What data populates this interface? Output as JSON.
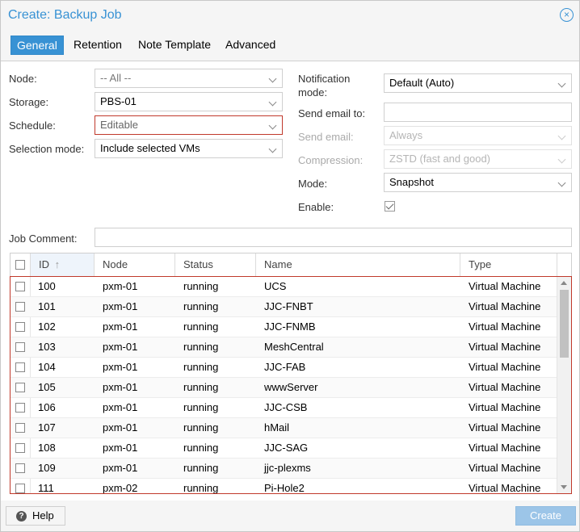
{
  "dialog": {
    "title": "Create: Backup Job",
    "close_icon": "×"
  },
  "tabs": [
    {
      "label": "General",
      "active": true
    },
    {
      "label": "Retention",
      "active": false
    },
    {
      "label": "Note Template",
      "active": false
    },
    {
      "label": "Advanced",
      "active": false
    }
  ],
  "form": {
    "node": {
      "label": "Node:",
      "value": "-- All --"
    },
    "storage": {
      "label": "Storage:",
      "value": "PBS-01"
    },
    "schedule": {
      "label": "Schedule:",
      "value": "Editable"
    },
    "selection_mode": {
      "label": "Selection mode:",
      "value": "Include selected VMs"
    },
    "notification_mode": {
      "label_line1": "Notification",
      "label_line2": "mode:",
      "value": "Default (Auto)"
    },
    "send_email_to": {
      "label": "Send email to:",
      "value": ""
    },
    "send_email": {
      "label": "Send email:",
      "value": "Always"
    },
    "compression": {
      "label": "Compression:",
      "value": "ZSTD (fast and good)"
    },
    "mode": {
      "label": "Mode:",
      "value": "Snapshot"
    },
    "enable": {
      "label": "Enable:",
      "checked": true
    },
    "job_comment": {
      "label": "Job Comment:",
      "value": ""
    }
  },
  "grid": {
    "columns": [
      "ID",
      "Node",
      "Status",
      "Name",
      "Type"
    ],
    "sort_icon": "↑",
    "rows": [
      {
        "id": "100",
        "node": "pxm-01",
        "status": "running",
        "name": "UCS",
        "type": "Virtual Machine"
      },
      {
        "id": "101",
        "node": "pxm-01",
        "status": "running",
        "name": "JJC-FNBT",
        "type": "Virtual Machine"
      },
      {
        "id": "102",
        "node": "pxm-01",
        "status": "running",
        "name": "JJC-FNMB",
        "type": "Virtual Machine"
      },
      {
        "id": "103",
        "node": "pxm-01",
        "status": "running",
        "name": "MeshCentral",
        "type": "Virtual Machine"
      },
      {
        "id": "104",
        "node": "pxm-01",
        "status": "running",
        "name": "JJC-FAB",
        "type": "Virtual Machine"
      },
      {
        "id": "105",
        "node": "pxm-01",
        "status": "running",
        "name": "wwwServer",
        "type": "Virtual Machine"
      },
      {
        "id": "106",
        "node": "pxm-01",
        "status": "running",
        "name": "JJC-CSB",
        "type": "Virtual Machine"
      },
      {
        "id": "107",
        "node": "pxm-01",
        "status": "running",
        "name": "hMail",
        "type": "Virtual Machine"
      },
      {
        "id": "108",
        "node": "pxm-01",
        "status": "running",
        "name": "JJC-SAG",
        "type": "Virtual Machine"
      },
      {
        "id": "109",
        "node": "pxm-01",
        "status": "running",
        "name": "jjc-plexms",
        "type": "Virtual Machine"
      },
      {
        "id": "111",
        "node": "pxm-02",
        "status": "running",
        "name": "Pi-Hole2",
        "type": "Virtual Machine"
      }
    ]
  },
  "footer": {
    "help_label": "Help",
    "help_icon": "?",
    "create_label": "Create"
  },
  "colors": {
    "accent": "#3892d4",
    "invalid_border": "#c0392b",
    "create_disabled": "#9cc5e8"
  }
}
